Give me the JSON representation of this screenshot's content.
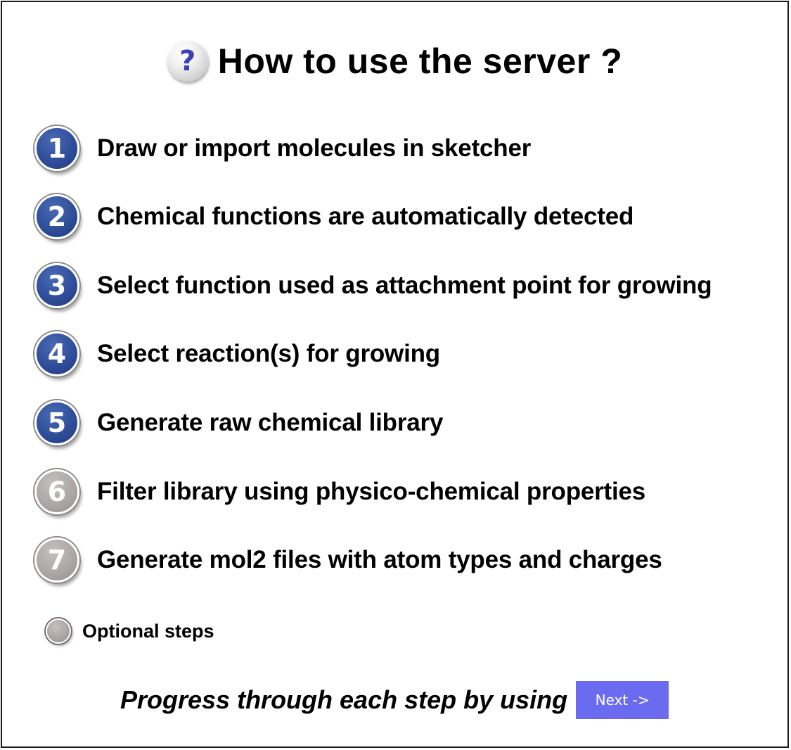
{
  "header": {
    "icon": "question-mark-icon",
    "icon_glyph": "?",
    "title": "How to use the server ?"
  },
  "steps": [
    {
      "number": "1",
      "label": "Draw or import molecules in sketcher",
      "optional": false
    },
    {
      "number": "2",
      "label": "Chemical functions are automatically detected",
      "optional": false
    },
    {
      "number": "3",
      "label": "Select function used as attachment point for growing",
      "optional": false
    },
    {
      "number": "4",
      "label": "Select reaction(s) for growing",
      "optional": false
    },
    {
      "number": "5",
      "label": "Generate raw chemical library",
      "optional": false
    },
    {
      "number": "6",
      "label": "Filter library using physico-chemical properties",
      "optional": true
    },
    {
      "number": "7",
      "label": "Generate mol2 files with atom types and charges",
      "optional": true
    }
  ],
  "legend": {
    "label": "Optional steps"
  },
  "footer": {
    "text": "Progress through each step by using",
    "next_label": "Next ->"
  },
  "colors": {
    "required_step": "#2d4b97",
    "optional_step": "#aaa5a4",
    "next_button": "#6b6bf0",
    "help_icon_glyph": "#3f3fb8"
  }
}
